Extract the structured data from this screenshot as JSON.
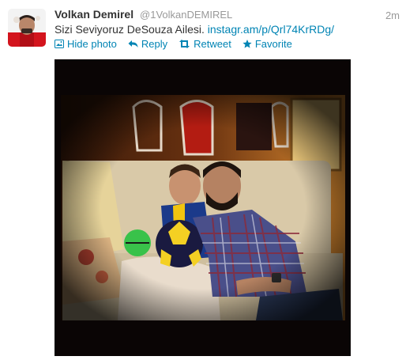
{
  "tweet": {
    "fullname": "Volkan Demirel",
    "handle": "@1VolkanDEMIREL",
    "timestamp": "2m",
    "text": "Sizi Seviyoruz DeSouza Ailesi.",
    "link": "instagr.am/p/Qrl74KrRDg/"
  },
  "actions": {
    "hide_photo": "Hide photo",
    "reply": "Reply",
    "retweet": "Retweet",
    "favorite": "Favorite"
  },
  "icons": {
    "hide_photo": "photo-icon",
    "reply": "reply-arrow-icon",
    "retweet": "retweet-icon",
    "favorite": "star-icon"
  },
  "colors": {
    "link": "#0084b4",
    "name": "#333333",
    "muted": "#999999",
    "photo_frame": "#0a0505"
  }
}
